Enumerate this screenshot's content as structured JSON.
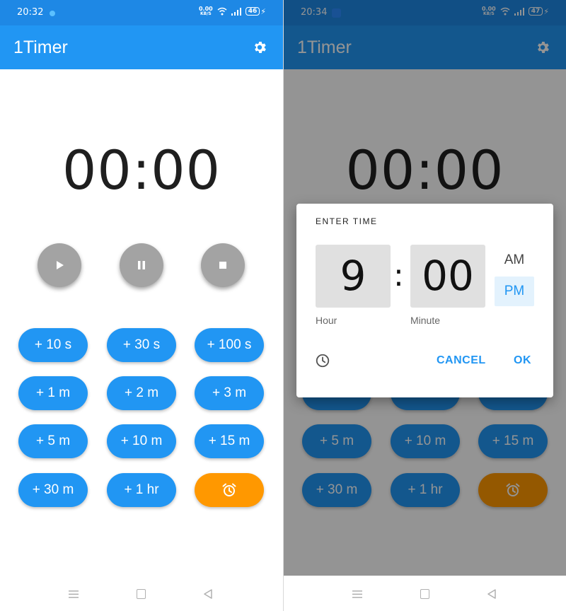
{
  "colors": {
    "primary": "#2196f3",
    "accent_orange": "#ff9800",
    "control_gray": "#a3a3a3",
    "text_dark": "#1f1f1f"
  },
  "left": {
    "status_bar": {
      "time": "20:32",
      "speed_top": "0.00",
      "speed_bottom": "KB/S",
      "battery": "46"
    },
    "app_bar": {
      "title": "1Timer",
      "settings_icon": "gear-icon"
    },
    "timer_display": "00:00",
    "controls": [
      {
        "name": "play-button",
        "icon": "play-icon"
      },
      {
        "name": "pause-button",
        "icon": "pause-icon"
      },
      {
        "name": "stop-button",
        "icon": "stop-icon"
      }
    ],
    "quick_add": [
      "+ 10 s",
      "+ 30 s",
      "+ 100 s",
      "+ 1 m",
      "+ 2 m",
      "+ 3 m",
      "+ 5 m",
      "+ 10 m",
      "+ 15 m",
      "+ 30 m",
      "+ 1 hr"
    ],
    "alarm_button_icon": "alarm-clock-icon"
  },
  "right": {
    "status_bar": {
      "time": "20:34",
      "speed_top": "0.00",
      "speed_bottom": "KB/S",
      "battery": "47"
    },
    "app_bar": {
      "title": "1Timer",
      "settings_icon": "gear-icon"
    },
    "timer_display": "00:00",
    "quick_add_visible": [
      "+ 5 m",
      "+ 10 m",
      "+ 15 m",
      "+ 30 m",
      "+ 1 hr"
    ],
    "dialog": {
      "title": "ENTER TIME",
      "hour": "9",
      "separator": ":",
      "minute": "00",
      "hour_label": "Hour",
      "minute_label": "Minute",
      "am": "AM",
      "pm": "PM",
      "selected_period": "PM",
      "cancel": "CANCEL",
      "ok": "OK",
      "mode_toggle_icon": "clock-icon"
    }
  }
}
